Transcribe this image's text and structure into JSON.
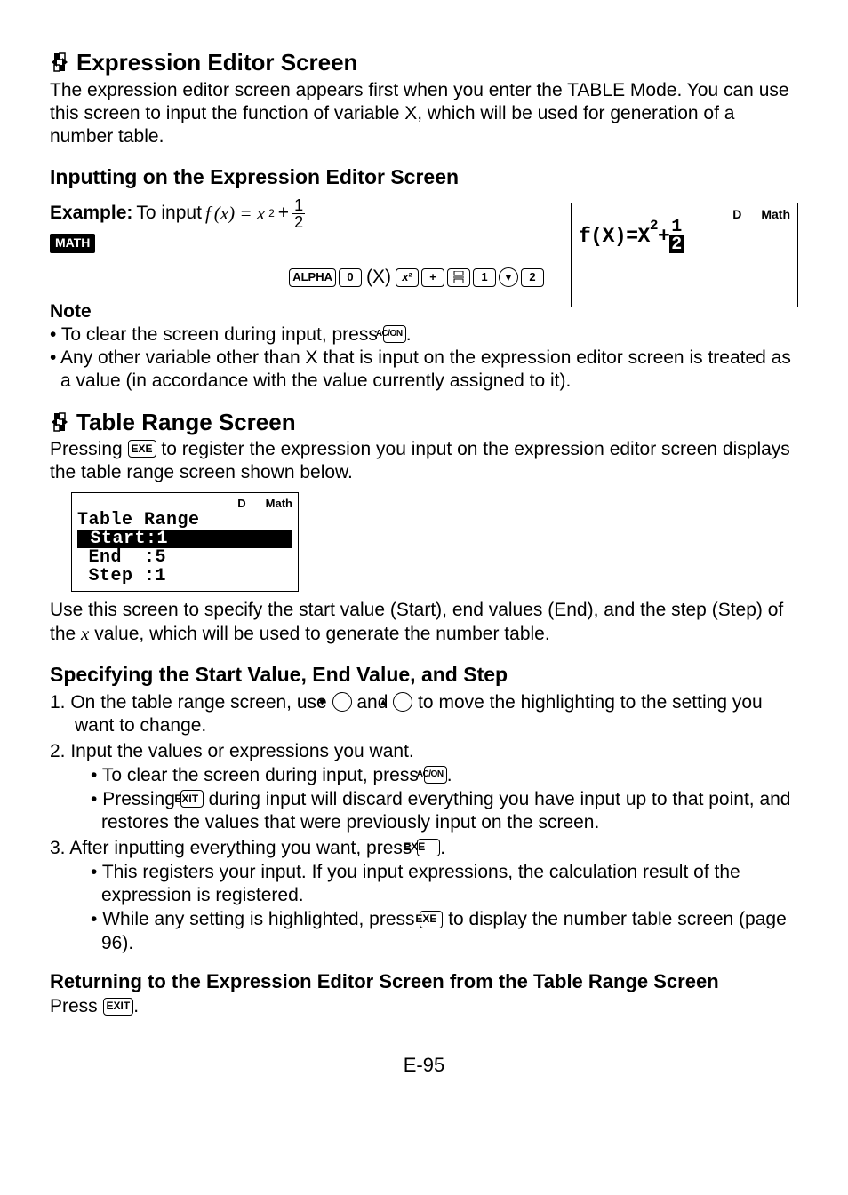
{
  "sec1": {
    "title": "Expression Editor Screen",
    "intro": "The expression editor screen appears first when you enter the TABLE Mode. You can use this screen to input the function of variable X, which will be used for generation of a number table.",
    "sub1": "Inputting on the Expression Editor Screen",
    "exampleLabel": "Example:",
    "exampleText": " To input ",
    "exprFx": "f",
    "exprParen": "(x) = x",
    "exprPlus": " + ",
    "badge": "MATH",
    "keys": {
      "alpha": "ALPHA",
      "zero": "0",
      "paren": "(X)",
      "x2": "x²",
      "plus": "+",
      "frac": "▯",
      "one": "1",
      "down": "▼",
      "two": "2"
    },
    "lcd": {
      "statusD": "D",
      "statusMath": "Math",
      "line1a": "f(X)=X",
      "line1sup": "2",
      "line1plus": "+",
      "frac_num": "1",
      "frac_den": "2"
    },
    "noteHead": "Note",
    "note1a": "To clear the screen during input, press ",
    "note1key": "AC/ON",
    "note1b": ".",
    "note2": "Any other variable other than X that is input on the expression editor screen is treated as a value (in accordance with the value currently assigned to it)."
  },
  "sec2": {
    "title": "Table Range Screen",
    "intro1": "Pressing ",
    "intro1key": "EXE",
    "intro2": " to register the expression you input on the expression editor screen displays the table range screen shown below.",
    "lcd": {
      "statusD": "D",
      "statusMath": "Math",
      "l1": "Table Range",
      "l2": " Start:1     ",
      "l3": " End  :5",
      "l4": " Step :1"
    },
    "post": "Use this screen to specify the start value (Start), end values (End), and the step (Step) of the x value, which will be used to generate the number table.",
    "xItalic": "x",
    "sub1": "Specifying the Start Value, End Value, and Step",
    "li1a": "1.  On the table range screen, use ",
    "li1down": "▼",
    "li1and": " and ",
    "li1up": "▲",
    "li1b": " to move the highlighting to the setting you want to change.",
    "li2": "2.  Input the values or expressions you want.",
    "li2b1a": "To clear the screen during input, press ",
    "li2b1key": "AC/ON",
    "li2b1b": ".",
    "li2b2a": "Pressing ",
    "li2b2key": "EXIT",
    "li2b2b": " during input will discard everything you have input up to that point, and restores the values that were previously input on the screen.",
    "li3a": "3.  After inputting everything you want, press ",
    "li3key": "EXE",
    "li3b": ".",
    "li3b1": "This registers your input. If you input expressions, the calculation result of the expression is registered.",
    "li3b2a": "While any setting is highlighted, press ",
    "li3b2key": "EXE",
    "li3b2b": " to display the number table screen (page 96).",
    "sub2": "Returning to the Expression Editor Screen from the Table Range Screen",
    "press1": "Press ",
    "presskey": "EXIT",
    "press2": "."
  },
  "pagenum": "E-95"
}
